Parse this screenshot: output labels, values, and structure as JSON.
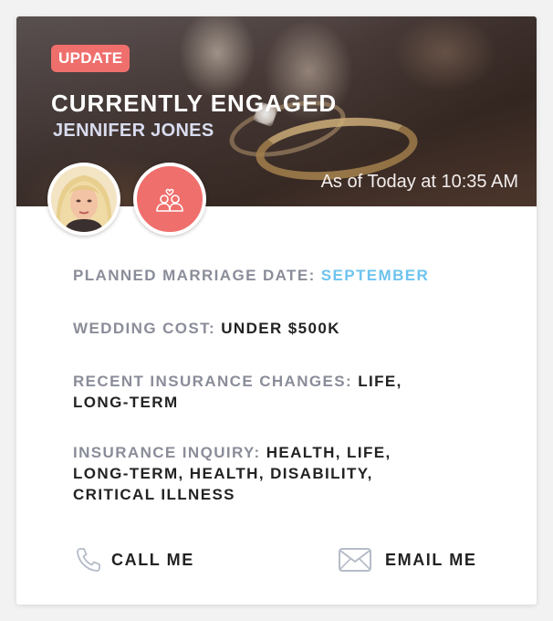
{
  "header": {
    "badge": "UPDATE",
    "title": "CURRENTLY ENGAGED",
    "subtitle": "JENNIFER JONES",
    "timestamp": "As of Today at 10:35 AM"
  },
  "avatar": {
    "icon": "person-photo"
  },
  "status_icon": {
    "icon": "couple-heart-icon"
  },
  "details": [
    {
      "label": "PLANNED MARRIAGE DATE:",
      "value_lines": [
        "SEPTEMBER"
      ],
      "accent": true
    },
    {
      "label": "WEDDING COST:",
      "value_lines": [
        "UNDER $500K"
      ],
      "accent": false
    },
    {
      "label": "RECENT INSURANCE CHANGES:",
      "value_lines": [
        "LIFE,",
        "LONG-TERM"
      ],
      "accent": false
    },
    {
      "label": "INSURANCE INQUIRY:",
      "value_lines": [
        "HEALTH, LIFE,",
        "LONG-TERM, HEALTH, DISABILITY,",
        "CRITICAL ILLNESS"
      ],
      "accent": false
    }
  ],
  "actions": {
    "call_label": "CALL ME",
    "email_label": "EMAIL ME"
  },
  "colors": {
    "badge": "#ef6f6c",
    "accent_value": "#6ec3ef",
    "label": "#8a8d99",
    "value": "#222222"
  }
}
